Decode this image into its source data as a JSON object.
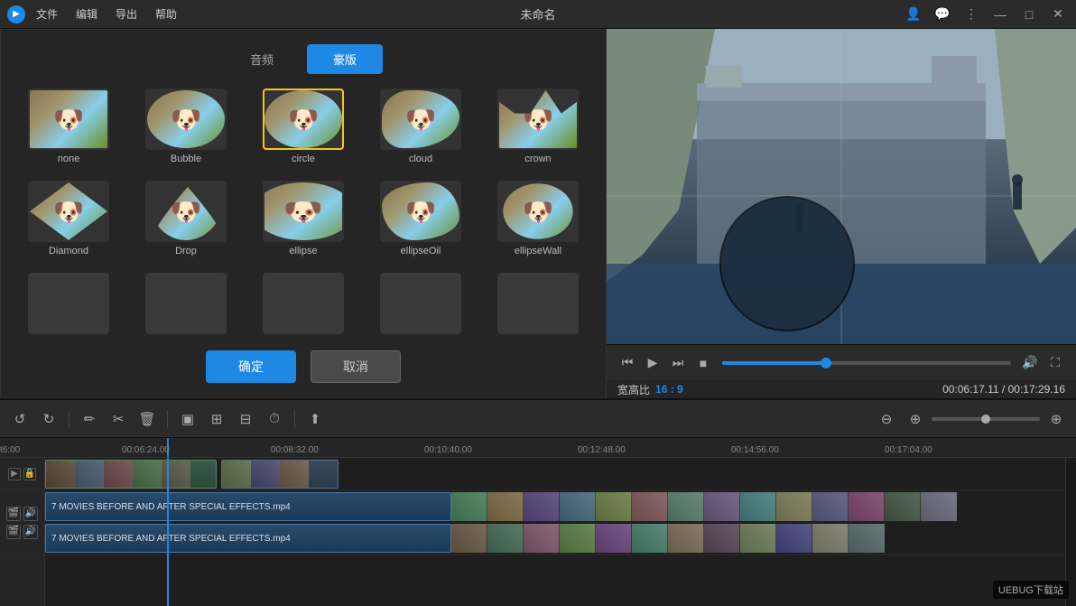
{
  "app": {
    "title": "未命名",
    "icon": "▶"
  },
  "menubar": {
    "items": [
      "文件",
      "编辑",
      "导出",
      "帮助"
    ]
  },
  "titlebar": {
    "title": "未命名",
    "minimize": "—",
    "maximize": "□",
    "close": "✕"
  },
  "tabs": {
    "audio_label": "音频",
    "premium_label": "豪版"
  },
  "effects": [
    {
      "id": "none",
      "label": "none",
      "selected": false
    },
    {
      "id": "bubble",
      "label": "Bubble",
      "selected": false
    },
    {
      "id": "circle",
      "label": "circle",
      "selected": true
    },
    {
      "id": "cloud",
      "label": "cloud",
      "selected": false
    },
    {
      "id": "crown",
      "label": "crown",
      "selected": false
    },
    {
      "id": "diamond",
      "label": "Diamond",
      "selected": false
    },
    {
      "id": "drop",
      "label": "Drop",
      "selected": false
    },
    {
      "id": "ellipse",
      "label": "ellipse",
      "selected": false
    },
    {
      "id": "ellipseOil",
      "label": "ellipseOil",
      "selected": false
    },
    {
      "id": "ellipseWall",
      "label": "ellipseWall",
      "selected": false
    }
  ],
  "buttons": {
    "confirm": "确定",
    "cancel": "取消"
  },
  "preview": {
    "aspect_ratio_label": "宽高比",
    "aspect_ratio_value": "16 : 9",
    "current_time": "00:06:17.11",
    "total_time": "00:17:29.16",
    "progress": 36
  },
  "timeline": {
    "toolbar": {
      "undo": "↺",
      "redo": "↻",
      "pen": "✏",
      "scissors": "✂",
      "trash": "🗑",
      "select": "▣",
      "frame": "⊞",
      "grid": "⊟",
      "clock": "⏱",
      "share": "⬆",
      "zoom_out": "⊖",
      "zoom_in": "⊕"
    },
    "rulers": [
      "t6:00",
      "00:06:24.00",
      "00:08:32.00",
      "00:10:40.00",
      "00:12:48.00",
      "00:14:56.00",
      "00:17:04.00"
    ],
    "clips": [
      {
        "label": "7 MOVIES BEFORE AND AFTER SPECIAL EFFECTS.mp4",
        "track": 1
      },
      {
        "label": "7 MOVIES BEFORE AND AFTER SPECIAL EFFECTS.mp4",
        "track": 2
      }
    ]
  },
  "watermark": "UEBUG下载站"
}
